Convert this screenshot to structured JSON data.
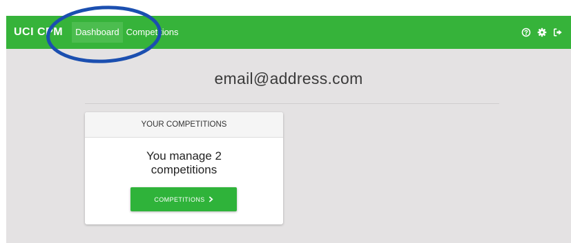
{
  "navbar": {
    "brand": "UCI CPM",
    "links": [
      {
        "label": "Dashboard",
        "active": true
      },
      {
        "label": "Competitions",
        "active": false
      }
    ],
    "icons": [
      "help-icon",
      "gear-icon",
      "sign-out-icon"
    ],
    "background": "#36b33a"
  },
  "main": {
    "user_email": "email@address.com",
    "card": {
      "header": "YOUR COMPETITIONS",
      "body_line1": "You manage 2",
      "body_line2": "competitions",
      "button_label": "COMPETITIONS",
      "button_icon": "chevron-right-icon"
    }
  },
  "annotation": {
    "shape": "ellipse",
    "color": "#1b4fb0"
  }
}
